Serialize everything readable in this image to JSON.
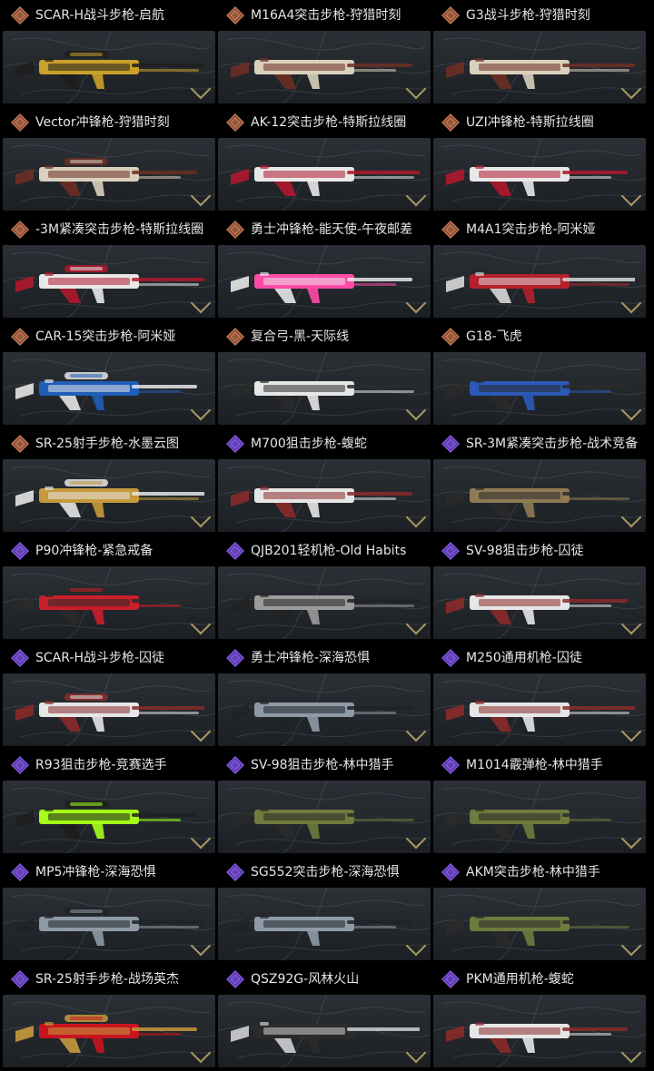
{
  "colors": {
    "legendary_accent": "#d07c55",
    "epic_accent": "#8b5cf6",
    "background": "#000000",
    "card_bg_top": "#2b3036",
    "card_bg_bottom": "#1c2024",
    "title_text": "#e6e6e6"
  },
  "items": [
    {
      "title": "SCAR-H战斗步枪-启航",
      "rarity": "legendary",
      "skin_colors": [
        "#caa12a",
        "#1e1e1e"
      ],
      "icon": "diamond-badge-icon"
    },
    {
      "title": "M16A4突击步枪-狩猎时刻",
      "rarity": "legendary",
      "skin_colors": [
        "#d9d0bd",
        "#6b2f23"
      ],
      "icon": "diamond-badge-icon"
    },
    {
      "title": "G3战斗步枪-狩猎时刻",
      "rarity": "legendary",
      "skin_colors": [
        "#d9d0bd",
        "#6b2f23"
      ],
      "icon": "diamond-badge-icon"
    },
    {
      "title": "Vector冲锋枪-狩猎时刻",
      "rarity": "legendary",
      "skin_colors": [
        "#d9d0bd",
        "#6b2f23"
      ],
      "icon": "diamond-badge-icon"
    },
    {
      "title": "AK-12突击步枪-特斯拉线圈",
      "rarity": "legendary",
      "skin_colors": [
        "#e8e8e8",
        "#b0182d"
      ],
      "icon": "diamond-badge-icon"
    },
    {
      "title": "UZI冲锋枪-特斯拉线圈",
      "rarity": "legendary",
      "skin_colors": [
        "#e8e8e8",
        "#b0182d"
      ],
      "icon": "diamond-badge-icon"
    },
    {
      "title": "-3M紧凑突击步枪-特斯拉线圈",
      "rarity": "legendary",
      "skin_colors": [
        "#e8e8e8",
        "#b0182d"
      ],
      "icon": "diamond-badge-icon"
    },
    {
      "title": "勇士冲锋枪-能天使-午夜邮差",
      "rarity": "legendary",
      "skin_colors": [
        "#ff4aa8",
        "#e8e8e8"
      ],
      "icon": "diamond-badge-icon"
    },
    {
      "title": "M4A1突击步枪-阿米娅",
      "rarity": "legendary",
      "skin_colors": [
        "#b5202b",
        "#d8d8d8"
      ],
      "icon": "diamond-badge-icon"
    },
    {
      "title": "CAR-15突击步枪-阿米娅",
      "rarity": "legendary",
      "skin_colors": [
        "#1f5db8",
        "#e6e6e6"
      ],
      "icon": "diamond-badge-icon"
    },
    {
      "title": "复合弓-黑-天际线",
      "rarity": "legendary",
      "skin_colors": [
        "#e6e6e6",
        "#2a2a2a"
      ],
      "icon": "diamond-badge-icon"
    },
    {
      "title": "G18-飞虎",
      "rarity": "legendary",
      "skin_colors": [
        "#2c59b8",
        "#2a2a2a"
      ],
      "icon": "diamond-badge-icon"
    },
    {
      "title": "SR-25射手步枪-水墨云图",
      "rarity": "legendary",
      "skin_colors": [
        "#c59a3c",
        "#e6e6e6"
      ],
      "icon": "diamond-badge-icon"
    },
    {
      "title": "M700狙击步枪-蝮蛇",
      "rarity": "epic",
      "skin_colors": [
        "#e6e6e6",
        "#8b2a2a"
      ],
      "icon": "diamond-badge-icon"
    },
    {
      "title": "SR-3M紧凑突击步枪-战术竞备",
      "rarity": "epic",
      "skin_colors": [
        "#8f7a54",
        "#2a2a2a"
      ],
      "icon": "diamond-badge-icon"
    },
    {
      "title": "P90冲锋枪-紧急戒备",
      "rarity": "epic",
      "skin_colors": [
        "#c81f2a",
        "#2a2a2a"
      ],
      "icon": "diamond-badge-icon"
    },
    {
      "title": "QJB201轻机枪-Old Habits",
      "rarity": "epic",
      "skin_colors": [
        "#9b9b9b",
        "#222222"
      ],
      "icon": "diamond-badge-icon"
    },
    {
      "title": "SV-98狙击步枪-囚徒",
      "rarity": "epic",
      "skin_colors": [
        "#e6e6e6",
        "#8b2a2a"
      ],
      "icon": "diamond-badge-icon"
    },
    {
      "title": "SCAR-H战斗步枪-囚徒",
      "rarity": "epic",
      "skin_colors": [
        "#e6e6e6",
        "#8b2a2a"
      ],
      "icon": "diamond-badge-icon"
    },
    {
      "title": "勇士冲锋枪-深海恐惧",
      "rarity": "epic",
      "skin_colors": [
        "#8f9aa6",
        "#1f2328"
      ],
      "icon": "diamond-badge-icon"
    },
    {
      "title": "M250通用机枪-囚徒",
      "rarity": "epic",
      "skin_colors": [
        "#e6e6e6",
        "#8b2a2a"
      ],
      "icon": "diamond-badge-icon"
    },
    {
      "title": "R93狙击步枪-竞赛选手",
      "rarity": "epic",
      "skin_colors": [
        "#a5ff18",
        "#1e1e1e"
      ],
      "icon": "diamond-badge-icon"
    },
    {
      "title": "SV-98狙击步枪-林中猎手",
      "rarity": "epic",
      "skin_colors": [
        "#6f7a3d",
        "#2a2a2a"
      ],
      "icon": "diamond-badge-icon"
    },
    {
      "title": "M1014霰弹枪-林中猎手",
      "rarity": "epic",
      "skin_colors": [
        "#6f7a3d",
        "#2a2a2a"
      ],
      "icon": "diamond-badge-icon"
    },
    {
      "title": "MP5冲锋枪-深海恐惧",
      "rarity": "epic",
      "skin_colors": [
        "#8f9aa6",
        "#1f2328"
      ],
      "icon": "diamond-badge-icon"
    },
    {
      "title": "SG552突击步枪-深海恐惧",
      "rarity": "epic",
      "skin_colors": [
        "#8f9aa6",
        "#1f2328"
      ],
      "icon": "diamond-badge-icon"
    },
    {
      "title": "AKM突击步枪-林中猎手",
      "rarity": "epic",
      "skin_colors": [
        "#6f7a3d",
        "#2a2a2a"
      ],
      "icon": "diamond-badge-icon"
    },
    {
      "title": "SR-25射手步枪-战场英杰",
      "rarity": "epic",
      "skin_colors": [
        "#c8141f",
        "#c59a3c"
      ],
      "icon": "diamond-badge-icon"
    },
    {
      "title": "QSZ92G-风林火山",
      "rarity": "epic",
      "skin_colors": [
        "#2b2b2b",
        "#d0d0d0"
      ],
      "icon": "diamond-badge-icon"
    },
    {
      "title": "PKM通用机枪-蝮蛇",
      "rarity": "epic",
      "skin_colors": [
        "#e6e6e6",
        "#8b2a2a"
      ],
      "icon": "diamond-badge-icon"
    }
  ]
}
